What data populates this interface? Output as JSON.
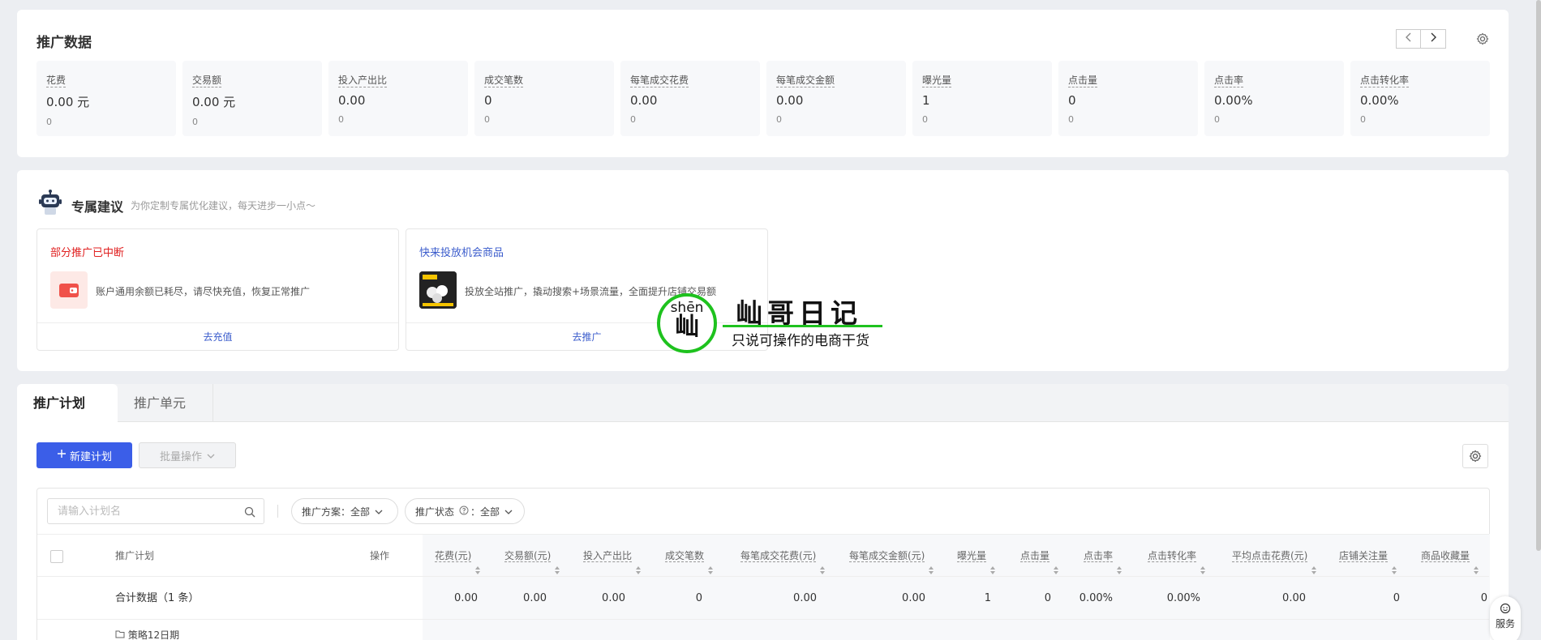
{
  "promo": {
    "title": "推广数据",
    "prev_icon": "chevron-left",
    "next_icon": "chevron-right",
    "metrics": [
      {
        "label": "花费",
        "value": "0.00 元",
        "sub": "0"
      },
      {
        "label": "交易额",
        "value": "0.00 元",
        "sub": "0"
      },
      {
        "label": "投入产出比",
        "value": "0.00",
        "sub": "0"
      },
      {
        "label": "成交笔数",
        "value": "0",
        "sub": "0"
      },
      {
        "label": "每笔成交花费",
        "value": "0.00",
        "sub": "0"
      },
      {
        "label": "每笔成交金额",
        "value": "0.00",
        "sub": "0"
      },
      {
        "label": "曝光量",
        "value": "1",
        "sub": "0"
      },
      {
        "label": "点击量",
        "value": "0",
        "sub": "0"
      },
      {
        "label": "点击率",
        "value": "0.00%",
        "sub": "0"
      },
      {
        "label": "点击转化率",
        "value": "0.00%",
        "sub": "0"
      }
    ]
  },
  "advice": {
    "title": "专属建议",
    "subtitle": "为你定制专属优化建议，每天进步一小点～",
    "cards": [
      {
        "heading": "部分推广已中断",
        "desc": "账户通用余额已耗尽，请尽快充值，恢复正常推广",
        "action": "去充值",
        "heading_color": "#e02020"
      },
      {
        "heading": "快来投放机会商品",
        "desc": "投放全站推广，撬动搜索+场景流量，全面提升店铺交易额",
        "action": "去推广",
        "heading_color": "#3b5ccc"
      }
    ]
  },
  "watermark": {
    "pinyin": "shēn",
    "char": "屾",
    "title": "屾哥日记",
    "subtitle": "只说可操作的电商干货"
  },
  "plan": {
    "tabs": [
      "推广计划",
      "推广单元"
    ],
    "new_button": "新建计划",
    "batch_button": "批量操作",
    "search_placeholder": "请输入计划名",
    "filter_scheme": "推广方案：全部",
    "filter_status_prefix": "推广状态",
    "filter_status_value": "：全部",
    "columns": {
      "plan": "推广计划",
      "op": "操作",
      "cost": "花费(元)",
      "gmv": "交易额(元)",
      "roi": "投入产出比",
      "orders": "成交笔数",
      "cost_per_order": "每笔成交花费(元)",
      "amount_per_order": "每笔成交金额(元)",
      "impressions": "曝光量",
      "clicks": "点击量",
      "ctr": "点击率",
      "cvr": "点击转化率",
      "avg_cpc": "平均点击花费(元)",
      "shop_follows": "店铺关注量",
      "fav": "商品收藏量"
    },
    "total_row": {
      "label": "合计数据（1 条）",
      "cost": "0.00",
      "gmv": "0.00",
      "roi": "0.00",
      "orders": "0",
      "cost_per_order": "0.00",
      "amount_per_order": "0.00",
      "impressions": "1",
      "clicks": "0",
      "ctr": "0.00%",
      "cvr": "0.00%",
      "avg_cpc": "0.00",
      "shop_follows": "0",
      "fav": "0"
    },
    "partial_row_text": "策略12日期"
  },
  "service": {
    "label": "服务"
  },
  "colors": {
    "primary": "#3b5ee8",
    "watermark_green": "#1ec21e",
    "alert_red": "#e02020"
  }
}
